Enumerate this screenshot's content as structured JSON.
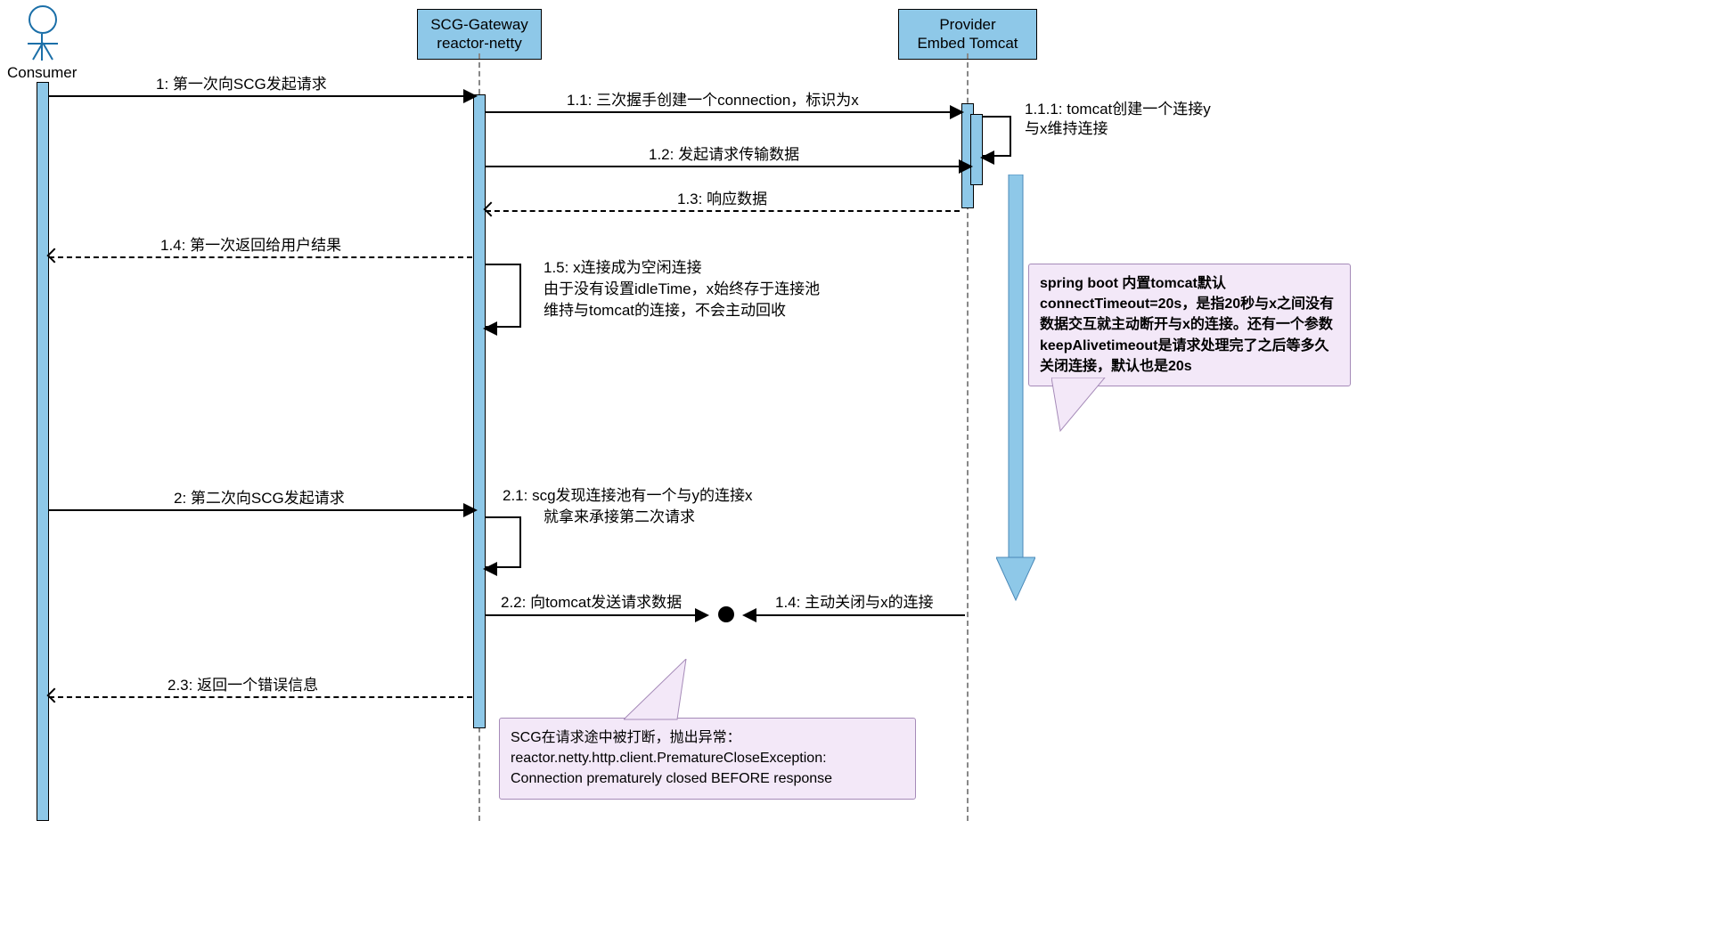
{
  "actors": {
    "consumer": {
      "label": "Consumer"
    },
    "gateway": {
      "line1": "SCG-Gateway",
      "line2": "reactor-netty"
    },
    "provider": {
      "line1": "Provider",
      "line2": "Embed Tomcat"
    }
  },
  "messages": {
    "m1": "1: 第一次向SCG发起请求",
    "m1_1": "1.1: 三次握手创建一个connection，标识为x",
    "m1_1_1a": "1.1.1: tomcat创建一个连接y",
    "m1_1_1b": "与x维持连接",
    "m1_2": "1.2: 发起请求传输数据",
    "m1_3": "1.3: 响应数据",
    "m1_4": "1.4: 第一次返回给用户结果",
    "m1_5a": "1.5: x连接成为空闲连接",
    "m1_5b": "由于没有设置idleTime，x始终存于连接池",
    "m1_5c": "维持与tomcat的连接，不会主动回收",
    "m2": "2: 第二次向SCG发起请求",
    "m2_1a": "2.1: scg发现连接池有一个与y的连接x",
    "m2_1b": "就拿来承接第二次请求",
    "m2_2": "2.2: 向tomcat发送请求数据",
    "m1_4close": "1.4: 主动关闭与x的连接",
    "m2_3": "2.3: 返回一个错误信息"
  },
  "notes": {
    "tomcat": "spring boot 内置tomcat默认connectTimeout=20s，是指20秒与x之间没有数据交互就主动断开与x的连接。还有一个参数keepAlivetimeout是请求处理完了之后等多久关闭连接，默认也是20s",
    "scgerr": "SCG在请求途中被打断，抛出异常：\nreactor.netty.http.client.PrematureCloseException:\nConnection prematurely closed BEFORE response"
  },
  "colors": {
    "lifeline_fill": "#8ec8e8",
    "note_fill": "#f3e8f8"
  },
  "chart_data": {
    "type": "sequence-diagram",
    "participants": [
      "Consumer",
      "SCG-Gateway reactor-netty",
      "Provider Embed Tomcat"
    ],
    "interactions": [
      {
        "from": "Consumer",
        "to": "SCG-Gateway",
        "kind": "sync",
        "label": "1: 第一次向SCG发起请求"
      },
      {
        "from": "SCG-Gateway",
        "to": "Provider",
        "kind": "sync",
        "label": "1.1: 三次握手创建一个connection，标识为x"
      },
      {
        "from": "Provider",
        "to": "Provider",
        "kind": "self",
        "label": "1.1.1: tomcat创建一个连接y 与x维持连接"
      },
      {
        "from": "SCG-Gateway",
        "to": "Provider",
        "kind": "sync",
        "label": "1.2: 发起请求传输数据"
      },
      {
        "from": "Provider",
        "to": "SCG-Gateway",
        "kind": "return",
        "label": "1.3: 响应数据"
      },
      {
        "from": "SCG-Gateway",
        "to": "Consumer",
        "kind": "return",
        "label": "1.4: 第一次返回给用户结果"
      },
      {
        "from": "SCG-Gateway",
        "to": "SCG-Gateway",
        "kind": "self",
        "label": "1.5: x连接成为空闲连接 由于没有设置idleTime，x始终存于连接池 维持与tomcat的连接，不会主动回收"
      },
      {
        "from": "Consumer",
        "to": "SCG-Gateway",
        "kind": "sync",
        "label": "2: 第二次向SCG发起请求"
      },
      {
        "from": "SCG-Gateway",
        "to": "SCG-Gateway",
        "kind": "self",
        "label": "2.1: scg发现连接池有一个与y的连接x 就拿来承接第二次请求"
      },
      {
        "from": "SCG-Gateway",
        "to": "collision",
        "kind": "sync",
        "label": "2.2: 向tomcat发送请求数据"
      },
      {
        "from": "Provider",
        "to": "collision",
        "kind": "sync",
        "label": "1.4: 主动关闭与x的连接"
      },
      {
        "from": "SCG-Gateway",
        "to": "Consumer",
        "kind": "return",
        "label": "2.3: 返回一个错误信息"
      }
    ],
    "notes": [
      {
        "attached_to": "Provider",
        "text": "spring boot 内置tomcat默认connectTimeout=20s，是指20秒与x之间没有数据交互就主动断开与x的连接。还有一个参数keepAlivetimeout是请求处理完了之后等多久关闭连接，默认也是20s"
      },
      {
        "attached_to": "collision",
        "text": "SCG在请求途中被打断，抛出异常：reactor.netty.http.client.PrematureCloseException: Connection prematurely closed BEFORE response"
      }
    ]
  }
}
